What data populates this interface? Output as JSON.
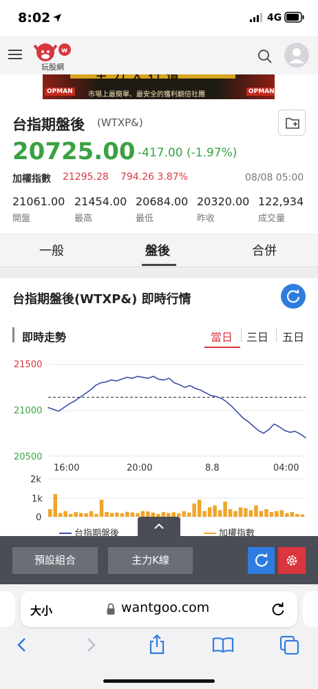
{
  "status_bar": {
    "time": "8:02",
    "network": "4G"
  },
  "header": {
    "logo_label": "玩股網"
  },
  "banner": {
    "brand_left": "OPMAN",
    "brand_right": "OPMAN",
    "headline": "主力大行情",
    "tagline": "市場上最簡單、最安全的獲利翻倍社團"
  },
  "quote": {
    "name": "台指期盤後",
    "symbol": "(WTXP&)",
    "price": "20725.00",
    "change": "-417.00 (-1.97%)",
    "index_label": "加權指數",
    "index_value": "21295.28",
    "index_change": "794.26 3.87%",
    "datetime": "08/08 05:00",
    "stats": [
      {
        "value": "21061.00",
        "label": "開盤"
      },
      {
        "value": "21454.00",
        "label": "最高"
      },
      {
        "value": "20684.00",
        "label": "最低"
      },
      {
        "value": "20320.00",
        "label": "昨收"
      },
      {
        "value": "122,934",
        "label": "成交量"
      }
    ]
  },
  "tabs": [
    {
      "label": "一般"
    },
    {
      "label": "盤後"
    },
    {
      "label": "合併"
    }
  ],
  "section": {
    "title": "台指期盤後(WTXP&) 即時行情",
    "subtitle": "即時走勢",
    "ranges": [
      "當日",
      "三日",
      "五日"
    ]
  },
  "chart_data": {
    "type": "line",
    "y_ticks": [
      "21500",
      "21000",
      "20500"
    ],
    "ylim": [
      20500,
      21500
    ],
    "x_ticks": [
      "16:00",
      "20:00",
      "8.8",
      "04:00"
    ],
    "reference_line": 21142,
    "series": [
      {
        "name": "台指期盤後",
        "color": "#3a4ea6",
        "values": [
          21030,
          21010,
          20990,
          21030,
          21070,
          21100,
          21140,
          21180,
          21220,
          21270,
          21300,
          21310,
          21330,
          21320,
          21340,
          21360,
          21350,
          21370,
          21360,
          21350,
          21370,
          21340,
          21330,
          21350,
          21300,
          21280,
          21250,
          21270,
          21240,
          21220,
          21190,
          21160,
          21150,
          21130,
          21090,
          21040,
          20980,
          20920,
          20880,
          20830,
          20780,
          20750,
          20790,
          20850,
          20820,
          20780,
          20760,
          20770,
          20740,
          20700
        ]
      }
    ],
    "volume_ticks": [
      "2k",
      "1k",
      "0"
    ],
    "volume_series": {
      "name": "加權指數",
      "color": "#f0a52a",
      "max": 2000,
      "values": [
        400,
        1200,
        200,
        300,
        150,
        250,
        200,
        180,
        300,
        150,
        900,
        250,
        200,
        220,
        180,
        260,
        230,
        190,
        300,
        280,
        220,
        150,
        250,
        200,
        240,
        180,
        300,
        220,
        700,
        900,
        300,
        500,
        600,
        350,
        800,
        400,
        300,
        500,
        450,
        350,
        600,
        300,
        400,
        250,
        300,
        350,
        200,
        250,
        150,
        120
      ]
    },
    "legend": [
      "台指期盤後",
      "加權指數"
    ]
  },
  "toolbar": {
    "preset_label": "預設組合",
    "main_k_label": "主力K線"
  },
  "browser": {
    "text_size_label": "大小",
    "url": "wantgoo.com"
  }
}
